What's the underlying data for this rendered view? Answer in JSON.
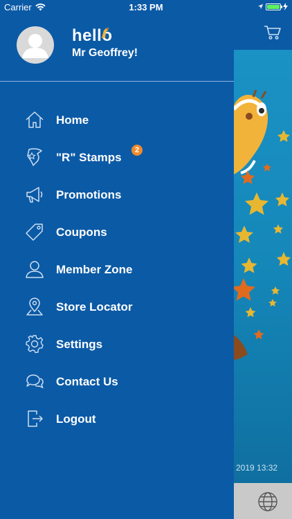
{
  "status_bar": {
    "carrier": "Carrier",
    "time": "1:33 PM",
    "battery_color": "#5ef25e"
  },
  "drawer": {
    "greeting": "hello",
    "user_name": "Mr Geoffrey!",
    "menu": [
      {
        "label": "Home",
        "icon": "home-icon"
      },
      {
        "label": "\"R\" Stamps",
        "icon": "stamp-icon",
        "badge": "2"
      },
      {
        "label": "Promotions",
        "icon": "megaphone-icon"
      },
      {
        "label": "Coupons",
        "icon": "tag-icon"
      },
      {
        "label": "Member Zone",
        "icon": "person-icon"
      },
      {
        "label": "Store Locator",
        "icon": "map-pin-icon"
      },
      {
        "label": "Settings",
        "icon": "gear-icon"
      },
      {
        "label": "Contact Us",
        "icon": "chat-icon"
      },
      {
        "label": "Logout",
        "icon": "logout-icon"
      }
    ]
  },
  "main": {
    "timestamp": "2019 13:32",
    "cart_icon": "cart-icon",
    "globe_icon": "globe-icon"
  },
  "colors": {
    "drawer_bg": "#0b5aa6",
    "badge": "#f08b2c"
  }
}
